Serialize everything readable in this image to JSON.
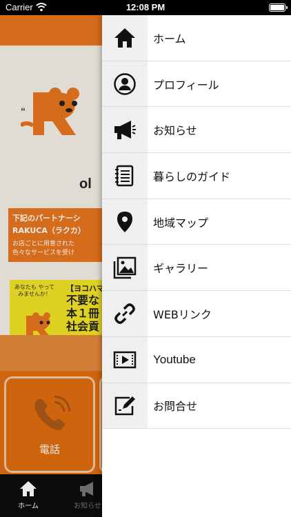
{
  "status_bar": {
    "carrier": "Carrier",
    "time": "12:08 PM"
  },
  "background_app": {
    "logo_sub": "ol",
    "notice": {
      "line1": "下記のパートナーシ",
      "line2": "RAKUCA（ラクカ）",
      "line3": "お店ごとに用意された",
      "line4": "色々なサービスを受け"
    },
    "promo": {
      "bubble": "あなたも やって みませんか！",
      "heading": "【ヨコハマ",
      "big_line1": "不要な",
      "big_line2": "本１冊",
      "big_line3": "社会貢"
    },
    "phone_tile_label": "電話",
    "tabs": [
      {
        "label": "ホーム"
      },
      {
        "label": "お知らせ"
      }
    ]
  },
  "menu": {
    "items": [
      {
        "label": "ホーム",
        "icon": "home-icon"
      },
      {
        "label": "プロフィール",
        "icon": "profile-icon"
      },
      {
        "label": "お知らせ",
        "icon": "megaphone-icon"
      },
      {
        "label": "暮らしのガイド",
        "icon": "notebook-icon"
      },
      {
        "label": "地域マップ",
        "icon": "map-pin-icon"
      },
      {
        "label": "ギャラリー",
        "icon": "gallery-icon"
      },
      {
        "label": "WEBリンク",
        "icon": "link-icon"
      },
      {
        "label": "Youtube",
        "icon": "video-icon"
      },
      {
        "label": "お問合せ",
        "icon": "contact-form-icon"
      }
    ]
  },
  "colors": {
    "accent": "#e8761e",
    "menu_icon_bg": "#efefef",
    "promo_yellow": "#f2e228"
  }
}
